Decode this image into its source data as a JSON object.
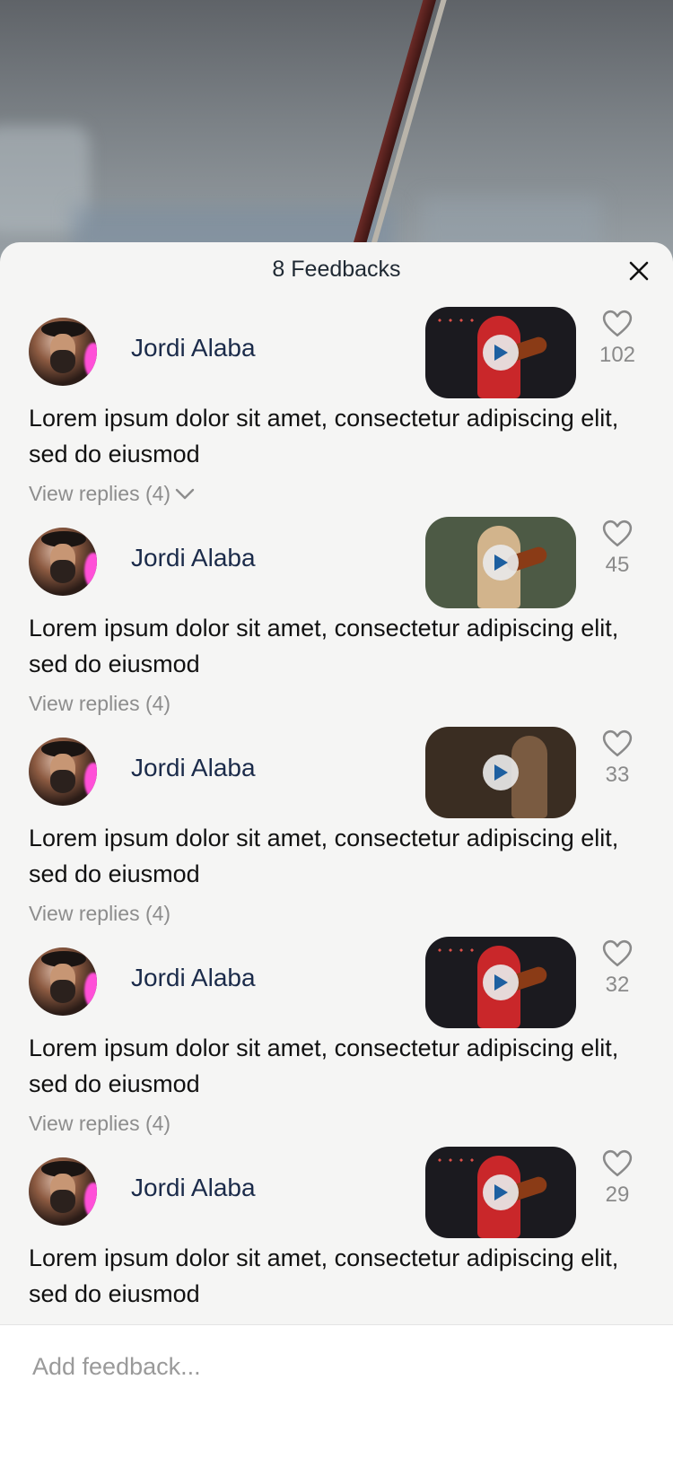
{
  "header": {
    "title": "8 Feedbacks",
    "close_icon": "close-icon"
  },
  "feedbacks": [
    {
      "name": "Jordi Alaba",
      "likes": "102",
      "text": "Lorem ipsum dolor sit amet, consectetur adipiscing elit, sed do eiusmod",
      "replies": "View replies (4)",
      "replies_expanded_icon": "chevron-down-icon",
      "thumb_colors": {
        "bg": "#1b1a1f",
        "person": "#c9272a"
      }
    },
    {
      "name": "Jordi Alaba",
      "likes": "45",
      "text": "Lorem ipsum dolor sit amet, consectetur adipiscing elit, sed do eiusmod",
      "replies": "View replies (4)",
      "thumb_colors": {
        "bg": "#4d5a45",
        "person": "#d2b48c"
      }
    },
    {
      "name": "Jordi Alaba",
      "likes": "33",
      "text": "Lorem ipsum dolor sit amet, consectetur adipiscing elit, sed do eiusmod",
      "replies": "View replies (4)",
      "thumb_colors": {
        "bg": "#3a2d22",
        "person": "#7a5b41"
      }
    },
    {
      "name": "Jordi Alaba",
      "likes": "32",
      "text": "Lorem ipsum dolor sit amet, consectetur adipiscing elit, sed do eiusmod",
      "replies": "View replies (4)",
      "thumb_colors": {
        "bg": "#1b1a1f",
        "person": "#c9272a"
      }
    },
    {
      "name": "Jordi Alaba",
      "likes": "29",
      "text": "Lorem ipsum dolor sit amet, consectetur adipiscing elit, sed do eiusmod",
      "replies": "",
      "thumb_colors": {
        "bg": "#1b1a1f",
        "person": "#c9272a"
      }
    }
  ],
  "composer": {
    "placeholder": "Add feedback..."
  },
  "colors": {
    "sheet_bg": "#f5f5f4",
    "name": "#1b2b4a",
    "muted": "#8d8d8d",
    "play_icon": "#1d5fa0"
  }
}
